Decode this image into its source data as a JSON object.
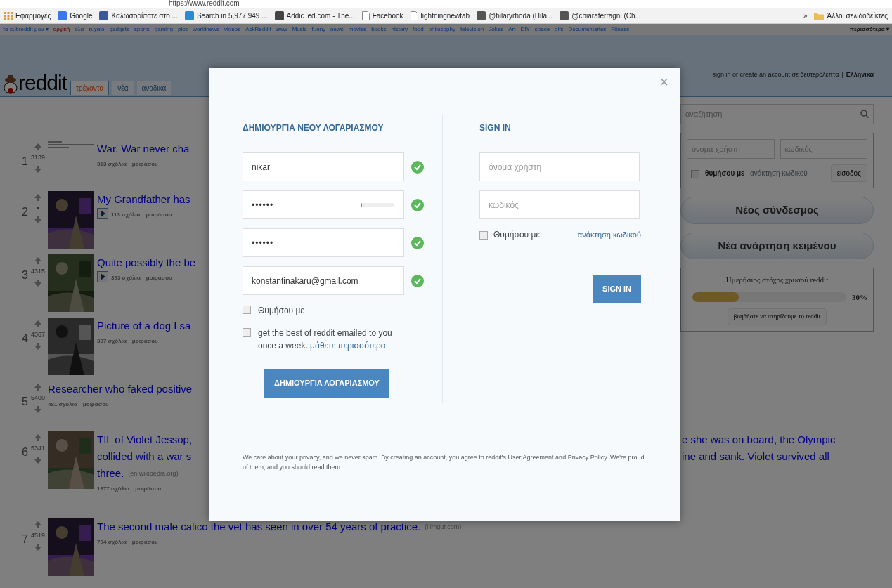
{
  "browser": {
    "address": "https://www.reddit.com",
    "bookmarks": [
      {
        "label": "Εφαρμογές",
        "kind": "apps"
      },
      {
        "label": "Google",
        "kind": "site",
        "color": "#3b78e7"
      },
      {
        "label": "Καλωσορίσατε στο ...",
        "kind": "site",
        "color": "#3b5998"
      },
      {
        "label": "Search in 5,977,949 ...",
        "kind": "site",
        "color": "#2a8ad4"
      },
      {
        "label": "AddicTed.com - The...",
        "kind": "site",
        "color": "#444444"
      },
      {
        "label": "Facebook",
        "kind": "page"
      },
      {
        "label": "lightningnewtab",
        "kind": "page"
      },
      {
        "label": "@hilaryrhoda (Hila...",
        "kind": "site",
        "color": "#555555"
      },
      {
        "label": "@chiaraferragni (Ch...",
        "kind": "site",
        "color": "#555555"
      }
    ],
    "overflow": "»",
    "other_bookmarks": "Άλλοι σελιδοδείκτες"
  },
  "subreddit_bar": {
    "items": [
      "τα subreddit μου ▾",
      "αρχική",
      "όλα",
      "τυχαίο",
      "gadgets",
      "sports",
      "gaming",
      "pics",
      "worldnews",
      "videos",
      "AskReddit",
      "aww",
      "Music",
      "funny",
      "news",
      "movies",
      "books",
      "history",
      "food",
      "philosophy",
      "television",
      "Jokes",
      "Art",
      "DIY",
      "space",
      "gifs",
      "Documentaries",
      "Fitness"
    ],
    "more": "περισσότερα ▾"
  },
  "header": {
    "logo": "reddit",
    "tabs": [
      {
        "label": "τρέχοντα",
        "selected": true
      },
      {
        "label": "νέα",
        "selected": false
      },
      {
        "label": "ανοδικά",
        "selected": false
      }
    ],
    "account_note": "sign in or create an account σε δευτερόλεπτα",
    "separator": "|",
    "language": "Ελληνικά"
  },
  "posts": [
    {
      "rank": "1",
      "score": "3139",
      "thumbnail": {
        "kind": "default"
      },
      "video": false,
      "title_lines": [
        {
          "left": "War. War never cha"
        }
      ],
      "comments": "313 σχόλια",
      "share": "μοιράσου"
    },
    {
      "rank": "2",
      "score": "•",
      "thumbnail": {
        "kind": "picture"
      },
      "video": true,
      "title_lines": [
        {
          "left": "My Grandfather has"
        }
      ],
      "comments": "113 σχόλια",
      "share": "μοιράσου"
    },
    {
      "rank": "3",
      "score": "4315",
      "thumbnail": {
        "kind": "picture"
      },
      "video": true,
      "title_lines": [
        {
          "left": "Quite possibly the be"
        }
      ],
      "comments": "393 σχόλια",
      "share": "μοιράσου"
    },
    {
      "rank": "4",
      "score": "4367",
      "thumbnail": {
        "kind": "picture"
      },
      "video": false,
      "title_lines": [
        {
          "left": "Picture of a dog I sa"
        }
      ],
      "comments": "337 σχόλια",
      "share": "μοιράσου"
    },
    {
      "rank": "5",
      "score": "5400",
      "video": false,
      "title_lines": [
        {
          "left": "Researcher who faked positive"
        }
      ],
      "comments": "481 σχόλια",
      "share": "μοιράσου"
    },
    {
      "rank": "6",
      "score": "5341",
      "thumbnail": {
        "kind": "picture"
      },
      "video": false,
      "title_lines": [
        {
          "left": "TIL of Violet Jessop,",
          "right": "e she was on board, the Olympic"
        },
        {
          "left": "collided with a war s",
          "right": "ine and sank. Violet survived all"
        },
        {
          "left": "three.",
          "domain": "(en.wikipedia.org)"
        }
      ],
      "comments": "1377 σχόλια",
      "share": "μοιράσου"
    },
    {
      "rank": "7",
      "score": "4519",
      "thumbnail": {
        "kind": "picture"
      },
      "video": false,
      "title_lines": [
        {
          "left": "The second male calico the vet has seen in over 54 years of practice.",
          "domain": "(i.imgur.com)"
        }
      ],
      "comments": "704 σχόλια",
      "share": "μοιράσου"
    }
  ],
  "sidebar": {
    "search_placeholder": "αναζήτηση",
    "login": {
      "username_placeholder": "όνομα χρήστη",
      "password_placeholder": "κωδικός",
      "remember": "θυμήσου με",
      "remember_checked": false,
      "recover": "ανάκτηση κωδικού",
      "submit": "είσοδος"
    },
    "buttons": [
      "Νέος σύνδεσμος",
      "Νέα ανάρτηση κειμένου"
    ],
    "gold": {
      "title": "Ημερήσιος στόχος χρυσού reddit",
      "level": 0.3,
      "reading": "30%",
      "button": "βοηθήστε να στηρίξουμε το reddit"
    }
  },
  "modal": {
    "close": "×",
    "register": {
      "title": "ΔΗΜΙΟΥΡΓΙΑ ΝΕΟΥ ΛΟΓΑΡΙΑΣΜΟΥ",
      "fields": [
        {
          "kind": "text",
          "value": "nikar",
          "valid": true
        },
        {
          "kind": "password",
          "value": "••••••",
          "valid": true,
          "strength": {
            "level": 0.05
          }
        },
        {
          "kind": "password",
          "value": "••••••",
          "valid": true
        },
        {
          "kind": "text",
          "value": "konstantinakaru@gmail.com",
          "valid": true
        }
      ],
      "checks": [
        {
          "label": "Θυμήσου με",
          "checked": false
        },
        {
          "label": "get the best of reddit emailed to you once a week.",
          "link": "μάθετε περισσότερα",
          "checked": false
        }
      ],
      "submit": "ΔΗΜΙΟΥΡΓΙΑ ΛΟΓΑΡΙΑΣΜΟΥ"
    },
    "signin": {
      "title": "SIGN IN",
      "username_placeholder": "όνομα χρήστη",
      "password_placeholder": "κωδικός",
      "remember": "Θυμήσου με",
      "remember_checked": false,
      "recover": "ανάκτηση κωδικού",
      "submit": "SIGN IN"
    },
    "footer": "We care about your privacy, and we never spam. By creating an account, you agree to reddit's User Agreement and Privacy Policy. We're proud of them, and you should read them."
  }
}
